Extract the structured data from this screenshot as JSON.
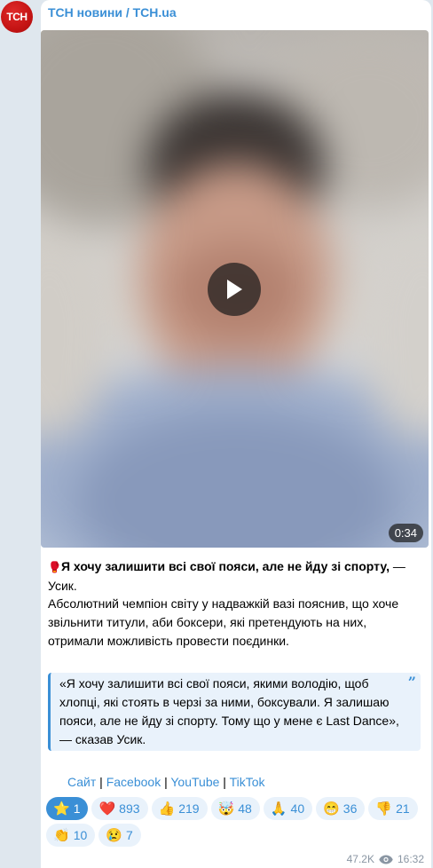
{
  "channel": {
    "avatar_text": "ТСН",
    "name": "ТСН новини / TCH.ua"
  },
  "video": {
    "duration": "0:34"
  },
  "post": {
    "headline_emoji": "🥊",
    "headline_bold": "Я хочу залишити всі свої пояси, але не йду зі спорту,",
    "headline_rest": " — Усик.",
    "paragraph": "Абсолютний чемпіон світу у надважкій вазі пояснив, що хоче звільнити титули, аби боксери, які претендують на них, отримали можливість провести поєдинки.",
    "quote": "«Я хочу залишити всі свої пояси, якими володію, щоб хлопці, які стоять в черзі за ними, боксували. Я залишаю пояси, але не йду зі спорту. Тому що у мене є Last Dance», — сказав Усик.",
    "quote_mark": "”"
  },
  "links": {
    "site": "Сайт",
    "facebook": "Facebook",
    "youtube": "YouTube",
    "tiktok": "TikTok",
    "separator": " | "
  },
  "reactions": [
    [
      {
        "emoji": "⭐",
        "count": "1",
        "active": true
      },
      {
        "emoji": "❤️",
        "count": "893"
      },
      {
        "emoji": "👍",
        "count": "219"
      },
      {
        "emoji": "🤯",
        "count": "48"
      },
      {
        "emoji": "🙏",
        "count": "40"
      },
      {
        "emoji": "😁",
        "count": "36"
      },
      {
        "emoji": "👎",
        "count": "21"
      }
    ],
    [
      {
        "emoji": "👏",
        "count": "10"
      },
      {
        "emoji": "😢",
        "count": "7"
      }
    ]
  ],
  "footer": {
    "views": "47.2K",
    "time": "16:32"
  },
  "colors": {
    "accent": "#3a8fd6",
    "brand_red": "#c41414"
  }
}
